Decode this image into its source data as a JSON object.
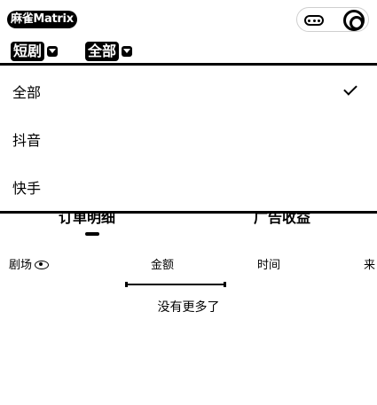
{
  "header": {
    "app_title": "麻雀Matrix"
  },
  "filters": {
    "category": "短剧",
    "scope": "全部"
  },
  "dropdown": {
    "options": [
      {
        "label": "全部",
        "selected": true
      },
      {
        "label": "抖音",
        "selected": false
      },
      {
        "label": "快手",
        "selected": false
      }
    ]
  },
  "tabs": [
    {
      "label": "订单明细"
    },
    {
      "label": "广告收益"
    }
  ],
  "columns": {
    "drama": "剧场",
    "amount": "金额",
    "time": "时间",
    "source": "来"
  },
  "empty_text": "没有更多了"
}
